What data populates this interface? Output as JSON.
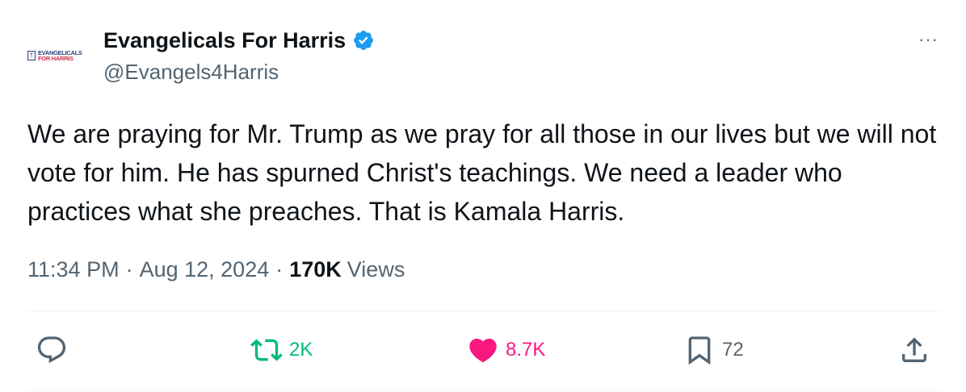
{
  "author": {
    "avatar_line1": "EVANGELICALS",
    "avatar_line2": "FOR HARRIS",
    "display_name": "Evangelicals For Harris",
    "handle": "@Evangels4Harris",
    "verified": true,
    "verified_color": "#1d9bf0"
  },
  "more_label": "···",
  "tweet": {
    "text": "We are praying for Mr. Trump as we pray for all those in our lives but we will not vote for him. He has spurned Christ's teachings. We need a leader who practices what she preaches. That is Kamala Harris."
  },
  "meta": {
    "time": "11:34 PM",
    "separator": "·",
    "date": "Aug 12, 2024",
    "views_count": "170K",
    "views_label": "Views"
  },
  "actions": {
    "reply": {
      "icon": "reply-icon",
      "count": ""
    },
    "retweet": {
      "icon": "retweet-icon",
      "count": "2K",
      "color": "#00ba7c"
    },
    "like": {
      "icon": "heart-icon",
      "count": "8.7K",
      "color": "#f91880",
      "liked": true
    },
    "bookmark": {
      "icon": "bookmark-icon",
      "count": "72"
    },
    "share": {
      "icon": "share-icon"
    }
  },
  "colors": {
    "text": "#0f1419",
    "secondary": "#536471",
    "divider": "#eff3f4"
  }
}
